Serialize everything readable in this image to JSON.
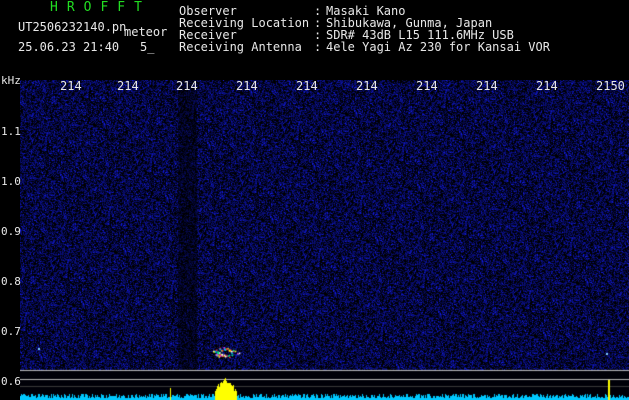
{
  "header": {
    "app_title": "HROFFT",
    "filename": "UT2506232140.pn",
    "meteor_tag": "meteor",
    "timestamp": "25.06.23 21:40",
    "count": "5_",
    "info": [
      {
        "label": "Observer",
        "colon": ":",
        "value": "Masaki Kano"
      },
      {
        "label": "Receiving Location",
        "colon": ":",
        "value": "Shibukawa, Gunma, Japan"
      },
      {
        "label": "Receiver",
        "colon": ":",
        "value": "SDR# 43dB L15 111.6MHz USB"
      },
      {
        "label": "Receiving Antenna",
        "colon": ":",
        "value": "4ele Yagi Az 230 for Kansai VOR"
      }
    ]
  },
  "plot": {
    "unit_label": "kHz",
    "y_ticks": [
      "1.1",
      "1.0",
      "0.9",
      "0.8",
      "0.7",
      "0.6"
    ],
    "time_ticks": [
      "214",
      "214",
      "214",
      "214",
      "214",
      "214",
      "214",
      "214",
      "214",
      "2150"
    ],
    "colors": {
      "background": "#000000",
      "noise": "#1018a0",
      "text": "#e8e8e8",
      "title": "#22dd22",
      "meteor_yellow": "#ffff00",
      "baseline": "#00c8ff"
    }
  }
}
